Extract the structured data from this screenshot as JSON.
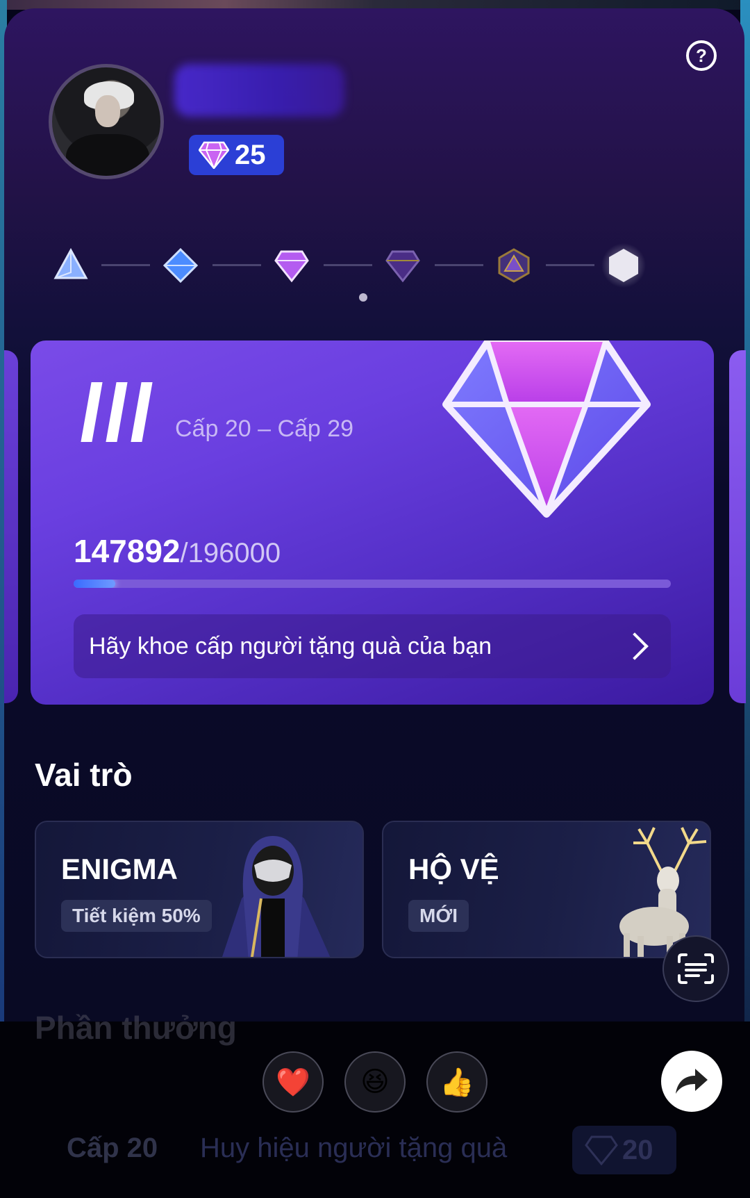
{
  "header": {
    "help_icon": "question-circle-icon",
    "level_badge": {
      "icon": "diamond-icon",
      "value": "25"
    }
  },
  "tiers": {
    "items": [
      "tier-1-triangle-icon",
      "tier-2-blue-diamond-icon",
      "tier-3-pink-diamond-icon",
      "tier-4-dark-gem-icon",
      "tier-5-hex-gem-icon",
      "tier-6-white-hexagon-icon"
    ],
    "active_index": 2
  },
  "level_card": {
    "roman_numeral": "III",
    "range": "Cấp 20 – Cấp 29",
    "progress_current": "147892",
    "progress_total": "/196000",
    "progress_fraction": 0.07,
    "share_text": "Hãy khoe cấp người tặng quà của bạn"
  },
  "roles": {
    "title": "Vai trò",
    "items": [
      {
        "title": "ENIGMA",
        "subtitle": "Tiết kiệm 50%"
      },
      {
        "title": "HỘ VỆ",
        "subtitle": "MỚI"
      }
    ]
  },
  "rewards": {
    "title": "Phần thưởng",
    "row": {
      "level": "Cấp 20",
      "description": "Huy hiệu người tặng quà",
      "badge_value": "20"
    }
  },
  "reactions": [
    "❤️",
    "😆",
    "👍"
  ],
  "colors": {
    "accent": "#6a3fe0",
    "badge_blue": "#2b3fd6",
    "gem_pink": "#d158f0"
  }
}
